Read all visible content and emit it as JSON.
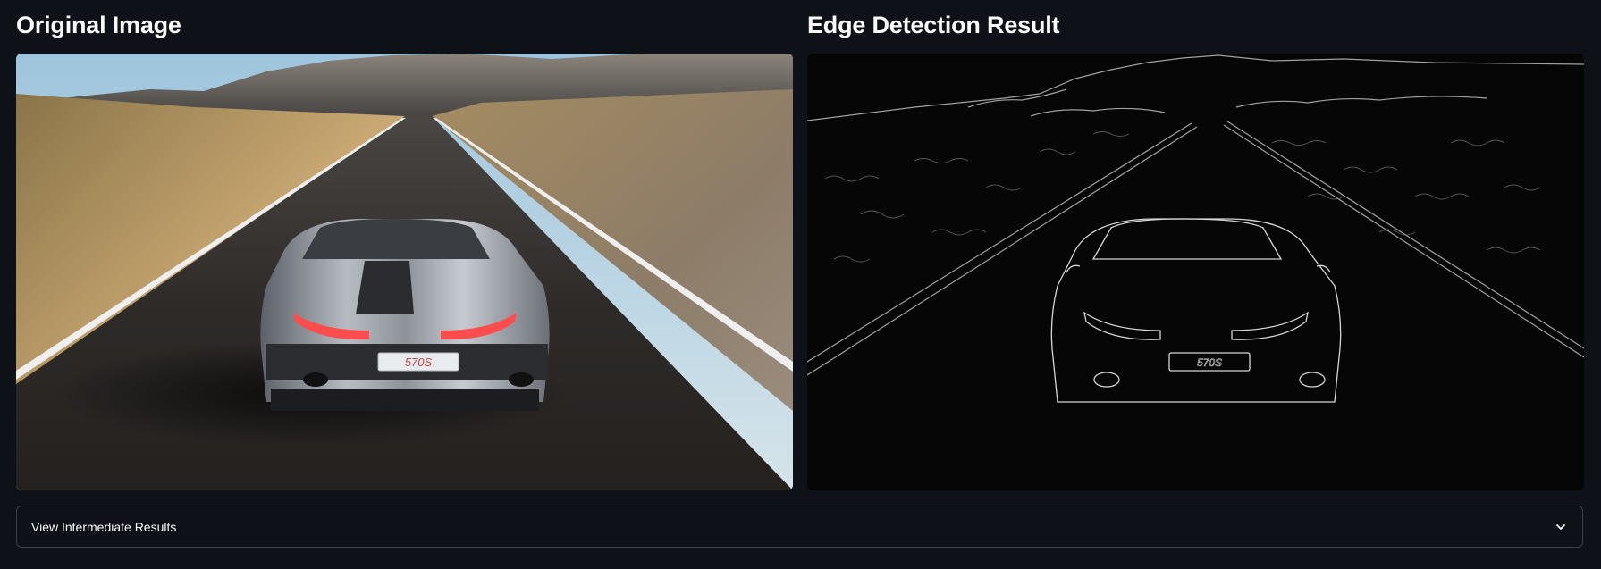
{
  "panels": {
    "original": {
      "heading": "Original Image",
      "plate_text": "570S"
    },
    "edges": {
      "heading": "Edge Detection Result",
      "plate_text": "570S"
    }
  },
  "expander": {
    "label": "View Intermediate Results",
    "icon": "chevron-down-icon",
    "expanded": false
  },
  "colors": {
    "background": "#0e1117",
    "text": "#fafafa",
    "border": "#3b3f48"
  }
}
